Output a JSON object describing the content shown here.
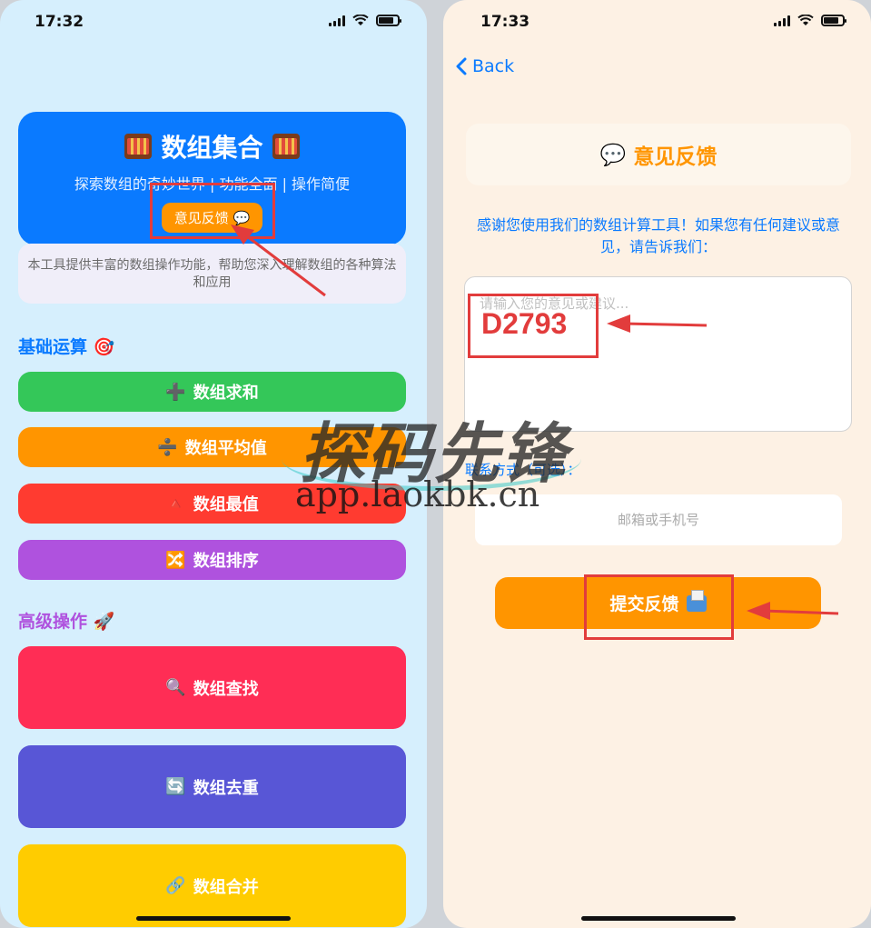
{
  "left_screen": {
    "status_time": "17:32",
    "hero": {
      "title": "数组集合",
      "subtitle": "探索数组的奇妙世界 | 功能全面 | 操作简便",
      "feedback_label": "意见反馈",
      "feedback_icon": "💬"
    },
    "info_text": "本工具提供丰富的数组操作功能，帮助您深入理解数组的各种算法和应用",
    "basic_section": {
      "title": "基础运算",
      "icon": "🎯",
      "color": "#0a7aff"
    },
    "basic_ops": [
      {
        "icon": "➕",
        "label": "数组求和",
        "color": "#34c759"
      },
      {
        "icon": "➗",
        "label": "数组平均值",
        "color": "#ff9500"
      },
      {
        "icon": "🔺",
        "label": "数组最值",
        "color": "#ff3b30"
      },
      {
        "icon": "🔀",
        "label": "数组排序",
        "color": "#af52de"
      }
    ],
    "advanced_section": {
      "title": "高级操作",
      "icon": "🚀",
      "color": "#af52de"
    },
    "advanced_ops": [
      {
        "icon": "🔍",
        "label": "数组查找",
        "color": "#ff2d55"
      },
      {
        "icon": "🔄",
        "label": "数组去重",
        "color": "#5856d6"
      },
      {
        "icon": "🔗",
        "label": "数组合并",
        "color": "#ffcc00"
      }
    ]
  },
  "right_screen": {
    "status_time": "17:33",
    "back_label": "Back",
    "header": {
      "icon": "💬",
      "title": "意见反馈"
    },
    "description": "感谢您使用我们的数组计算工具！如果您有任何建议或意见，请告诉我们：",
    "feedback_placeholder": "请输入您的意见或建议...",
    "annotation_code": "D2793",
    "contact_label": "联系方式（可选）：",
    "contact_placeholder": "邮箱或手机号",
    "submit_label": "提交反馈",
    "submit_icon": "📤"
  },
  "watermark": {
    "brand": "探码先锋",
    "url": "app.laokbk.cn"
  }
}
